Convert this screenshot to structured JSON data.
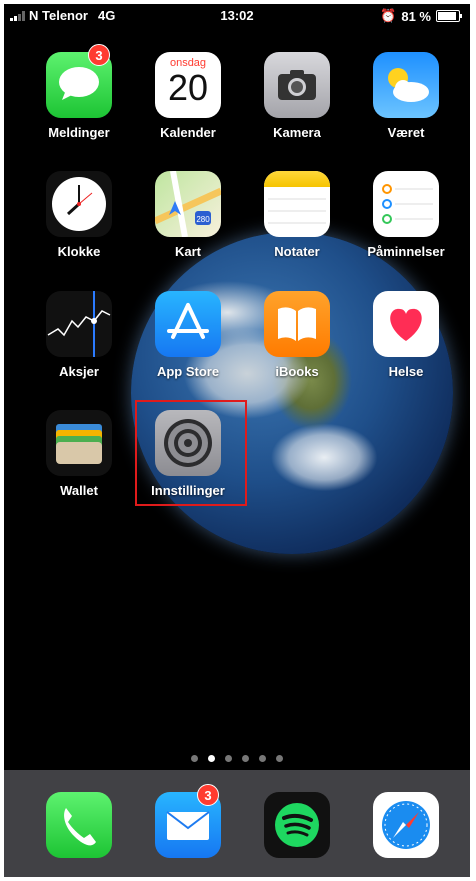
{
  "status_bar": {
    "carrier": "N Telenor",
    "network": "4G",
    "time": "13:02",
    "battery": "81 %",
    "battery_level": 0.81
  },
  "apps": [
    {
      "label": "Meldinger",
      "icon": "messages-icon",
      "badge": "3"
    },
    {
      "label": "Kalender",
      "icon": "calendar-icon",
      "calendar_day": "onsdag",
      "calendar_date": "20"
    },
    {
      "label": "Kamera",
      "icon": "camera-icon"
    },
    {
      "label": "Været",
      "icon": "weather-icon"
    },
    {
      "label": "Klokke",
      "icon": "clock-icon"
    },
    {
      "label": "Kart",
      "icon": "maps-icon",
      "map_sign": "280"
    },
    {
      "label": "Notater",
      "icon": "notes-icon"
    },
    {
      "label": "Påminnelser",
      "icon": "reminders-icon"
    },
    {
      "label": "Aksjer",
      "icon": "stocks-icon"
    },
    {
      "label": "App Store",
      "icon": "app-store-icon"
    },
    {
      "label": "iBooks",
      "icon": "ibooks-icon"
    },
    {
      "label": "Helse",
      "icon": "health-icon"
    },
    {
      "label": "Wallet",
      "icon": "wallet-icon"
    },
    {
      "label": "Innstillinger",
      "icon": "settings-icon"
    }
  ],
  "page_dots": {
    "count": 6,
    "active_index": 1
  },
  "dock": [
    {
      "icon": "phone-icon"
    },
    {
      "icon": "mail-icon",
      "badge": "3"
    },
    {
      "icon": "spotify-icon"
    },
    {
      "icon": "safari-icon"
    }
  ],
  "colors": {
    "highlight": "#e01b1b",
    "badge": "#ff3b30"
  }
}
